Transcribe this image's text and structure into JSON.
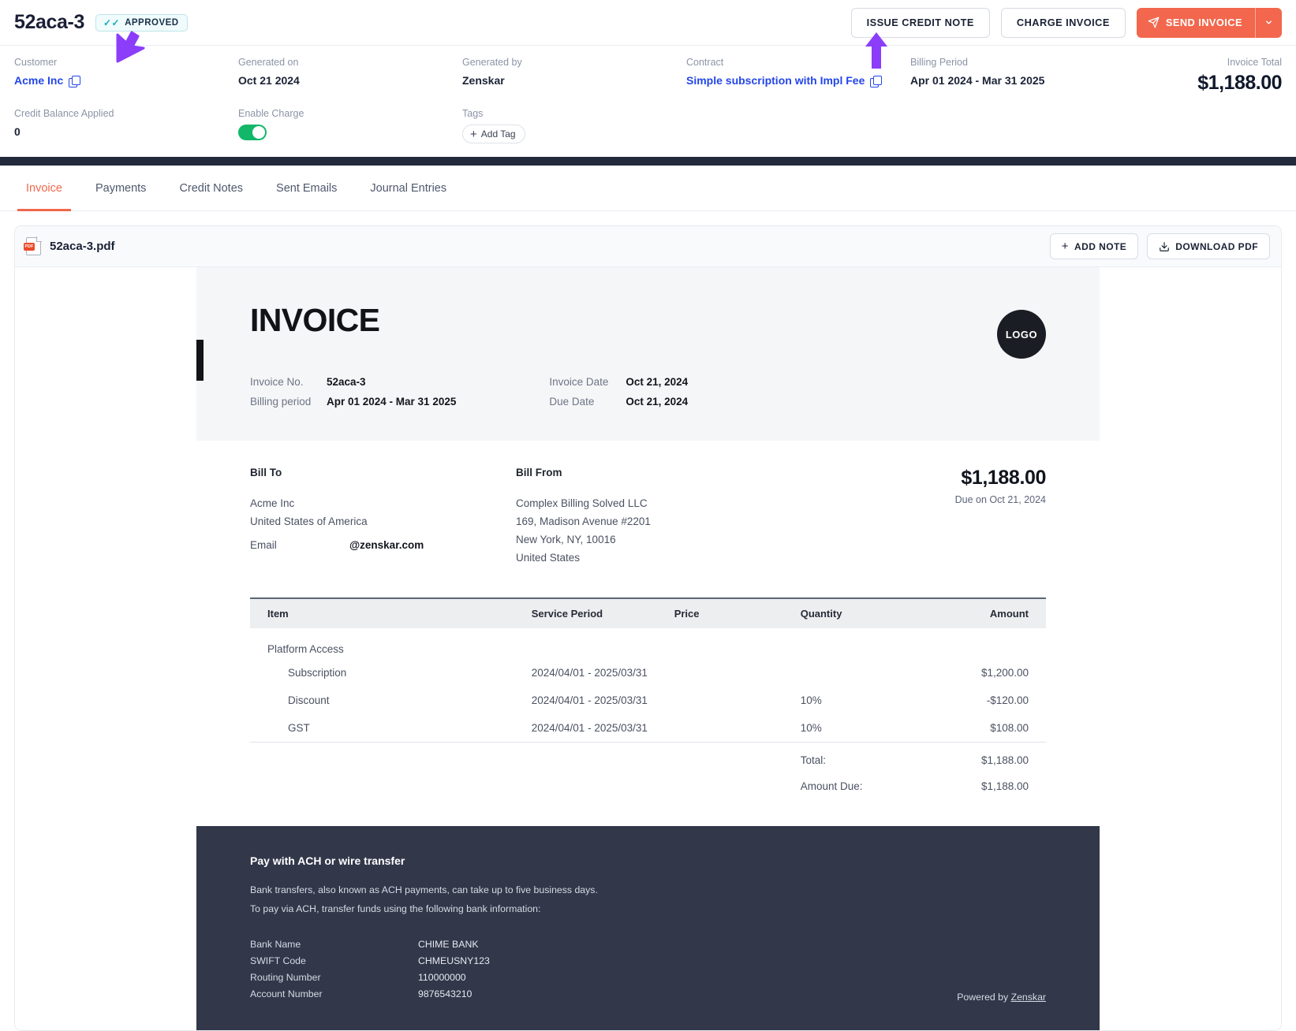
{
  "header": {
    "invoice_id": "52aca-3",
    "status_badge": "APPROVED",
    "actions": {
      "issue_credit_note": "ISSUE CREDIT NOTE",
      "charge_invoice": "CHARGE INVOICE",
      "send_invoice": "SEND INVOICE"
    }
  },
  "meta": {
    "customer_label": "Customer",
    "customer_value": "Acme Inc",
    "generated_on_label": "Generated on",
    "generated_on_value": "Oct 21 2024",
    "generated_by_label": "Generated by",
    "generated_by_value": "Zenskar",
    "contract_label": "Contract",
    "contract_value": "Simple subscription with Impl Fee",
    "billing_period_label": "Billing Period",
    "billing_period_value": "Apr 01 2024 - Mar 31 2025",
    "invoice_total_label": "Invoice Total",
    "invoice_total_value": "$1,188.00",
    "credit_balance_label": "Credit Balance Applied",
    "credit_balance_value": "0",
    "enable_charge_label": "Enable Charge",
    "tags_label": "Tags",
    "add_tag": "Add Tag"
  },
  "tabs": [
    {
      "label": "Invoice"
    },
    {
      "label": "Payments"
    },
    {
      "label": "Credit Notes"
    },
    {
      "label": "Sent Emails"
    },
    {
      "label": "Journal Entries"
    }
  ],
  "doc_toolbar": {
    "filename": "52aca-3.pdf",
    "add_note": "ADD NOTE",
    "download_pdf": "DOWNLOAD PDF"
  },
  "pdf": {
    "title": "INVOICE",
    "logo_text": "LOGO",
    "facts_left": [
      {
        "label": "Invoice No.",
        "value": "52aca-3"
      },
      {
        "label": "Billing period",
        "value": "Apr 01 2024 - Mar 31 2025"
      }
    ],
    "facts_right": [
      {
        "label": "Invoice Date",
        "value": "Oct 21, 2024"
      },
      {
        "label": "Due Date",
        "value": "Oct 21, 2024"
      }
    ],
    "bill_to": {
      "heading": "Bill To",
      "lines": [
        "Acme Inc",
        "United States of America"
      ],
      "email_label": "Email",
      "email_value": "@zenskar.com"
    },
    "bill_from": {
      "heading": "Bill From",
      "lines": [
        "Complex Billing Solved LLC",
        "169, Madison Avenue #2201",
        "New York, NY, 10016",
        "United States"
      ]
    },
    "amount_block": {
      "amount": "$1,188.00",
      "due_text": "Due on Oct 21, 2024"
    },
    "table": {
      "columns": [
        "Item",
        "Service Period",
        "Price",
        "Quantity",
        "Amount"
      ],
      "group_label": "Platform Access",
      "rows": [
        {
          "item": "Subscription",
          "period": "2024/04/01 - 2025/03/31",
          "price": "",
          "qty": "",
          "amount": "$1,200.00"
        },
        {
          "item": "Discount",
          "period": "2024/04/01 - 2025/03/31",
          "price": "",
          "qty": "10%",
          "amount": "-$120.00"
        },
        {
          "item": "GST",
          "period": "2024/04/01 - 2025/03/31",
          "price": "",
          "qty": "10%",
          "amount": "$108.00"
        }
      ],
      "total_label": "Total:",
      "total_value": "$1,188.00",
      "amount_due_label": "Amount Due:",
      "amount_due_value": "$1,188.00"
    },
    "footer": {
      "heading": "Pay with ACH or wire transfer",
      "p1": "Bank transfers, also known as ACH payments, can take up to five business days.",
      "p2": "To pay via ACH, transfer funds using the following bank information:",
      "bank": [
        {
          "k": "Bank Name",
          "v": "CHIME BANK"
        },
        {
          "k": "SWIFT Code",
          "v": "CHMEUSNY123"
        },
        {
          "k": "Routing Number",
          "v": "110000000"
        },
        {
          "k": "Account Number",
          "v": "9876543210"
        }
      ],
      "powered_prefix": "Powered by ",
      "powered_brand": "Zenskar"
    }
  },
  "colors": {
    "accent": "#f2674d",
    "link": "#2346e8",
    "toggle_on": "#12b76a",
    "cursor": "#8b3dfa",
    "footer_bg": "#32374a"
  }
}
